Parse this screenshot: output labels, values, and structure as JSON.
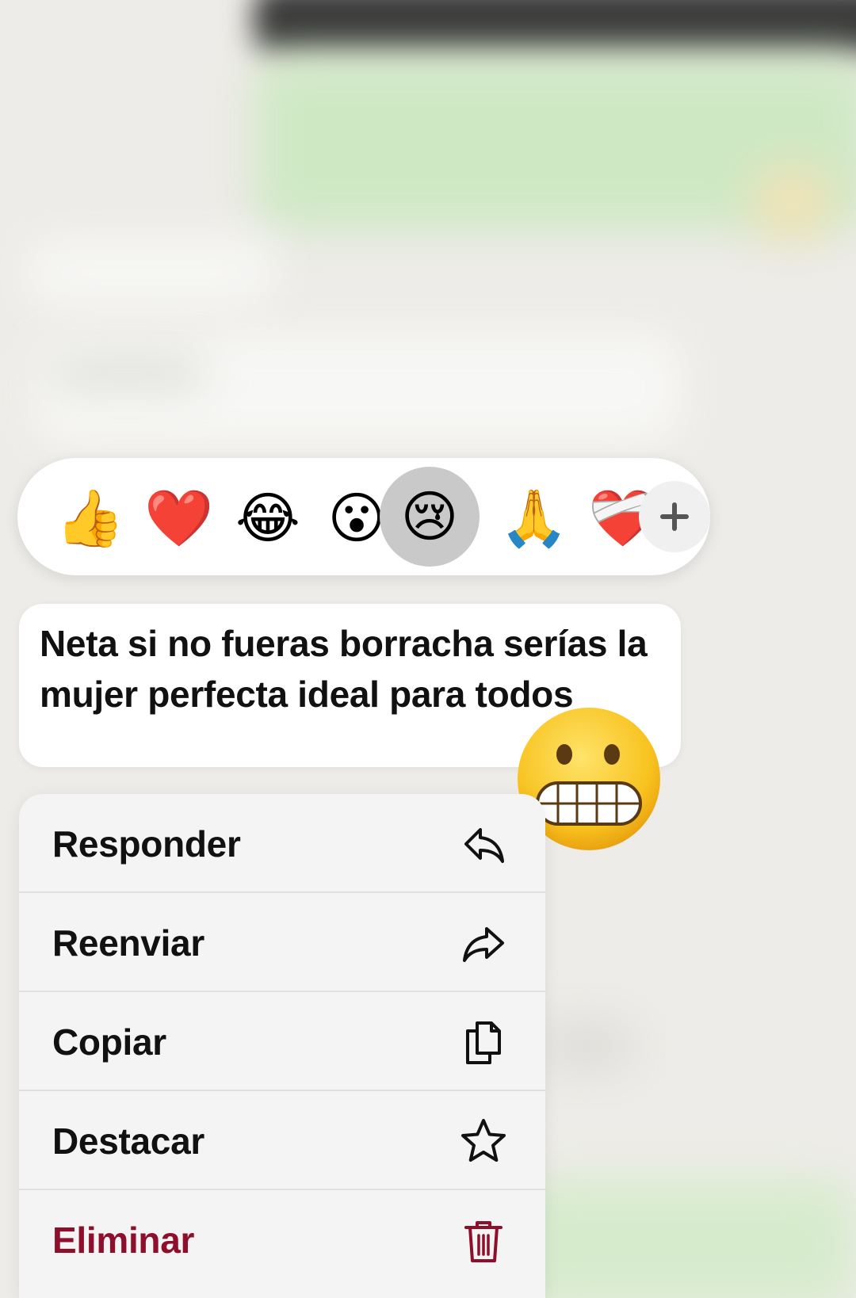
{
  "reactions": {
    "emojis": [
      "👍",
      "❤️",
      "😂",
      "😮",
      "😢",
      "🙏",
      "❤️‍🩹"
    ],
    "selected_index": 4,
    "more_label": "+"
  },
  "message": {
    "text": "Neta si no fueras borracha serías la mujer perfecta ideal para todos",
    "sticker_emoji": "grimacing-face"
  },
  "menu": {
    "items": [
      {
        "label": "Responder",
        "icon": "reply-icon"
      },
      {
        "label": "Reenviar",
        "icon": "forward-icon"
      },
      {
        "label": "Copiar",
        "icon": "copy-icon"
      },
      {
        "label": "Destacar",
        "icon": "star-icon"
      },
      {
        "label": "Eliminar",
        "icon": "trash-icon",
        "danger": true
      }
    ]
  },
  "colors": {
    "danger": "#8e0f2c",
    "selected_reaction_bg": "#c9c9c9",
    "menu_bg": "#f4f4f4"
  }
}
